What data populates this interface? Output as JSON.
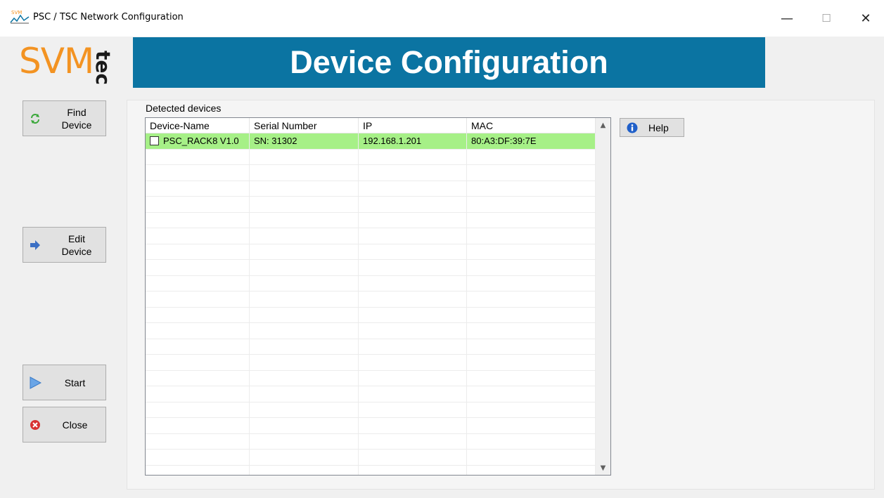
{
  "window": {
    "title": "PSC / TSC Network Configuration",
    "minimize": "—",
    "maximize": "☐",
    "close": "✕"
  },
  "logo": {
    "main": "SVM",
    "sub": "tec"
  },
  "banner": {
    "title": "Device Configuration"
  },
  "sidebar": {
    "find_device": "Find Device",
    "edit_device": "Edit Device",
    "start": "Start",
    "close": "Close"
  },
  "devices": {
    "label": "Detected devices",
    "columns": [
      "Device-Name",
      "Serial Number",
      "IP",
      "MAC"
    ],
    "rows": [
      {
        "name": "PSC_RACK8 V1.0",
        "serial": "SN: 31302",
        "ip": "192.168.1.201",
        "mac": "80:A3:DF:39:7E",
        "checked": false,
        "highlight": "#a6f087"
      }
    ]
  },
  "help": {
    "label": "Help"
  },
  "colors": {
    "banner": "#0b74a2",
    "logo_orange": "#f39322",
    "row_highlight": "#a6f087"
  }
}
